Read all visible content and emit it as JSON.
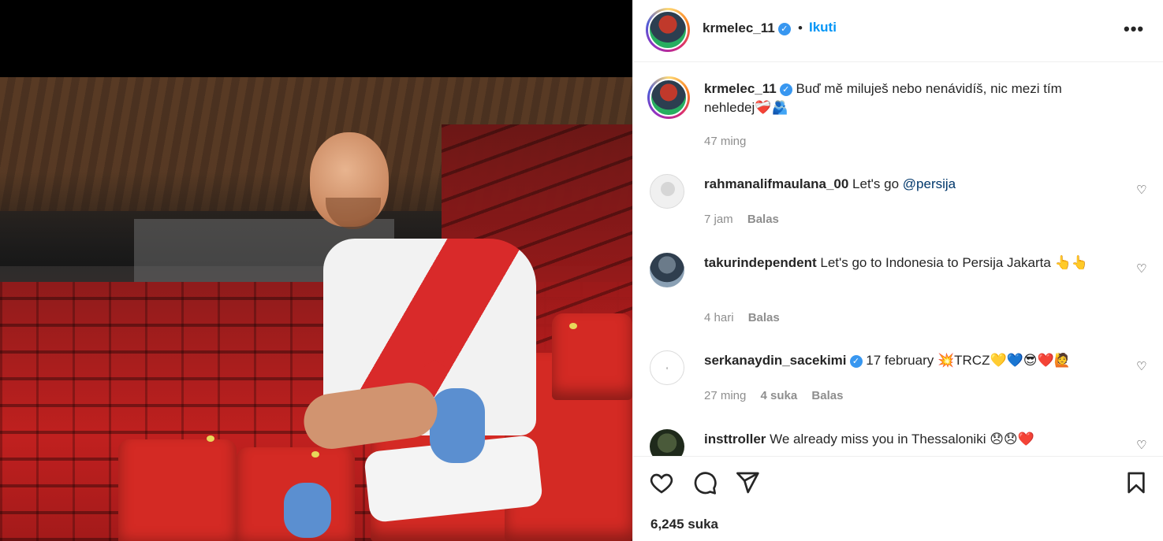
{
  "post": {
    "username": "krmelec_11",
    "verified_mark": "✓",
    "separator": "•",
    "follow_label": "Ikuti",
    "more_label": "•••"
  },
  "caption": {
    "username": "krmelec_11",
    "text": "Buď mě miluješ nebo nenávidíš, nic mezi tím nehledej❤️‍🩹🫂",
    "time": "47 ming"
  },
  "comments": [
    {
      "username": "rahmanalifmaulana_00",
      "text": "Let's go ",
      "mention": "@persija",
      "time": "7 jam",
      "likes": "",
      "reply_label": "Balas",
      "avatar": "default-avatar-icon"
    },
    {
      "username": "takurindependent",
      "text": "Let's go to Indonesia to Persija Jakarta 👆👆",
      "time": "4 hari",
      "likes": "",
      "reply_label": "Balas",
      "avatar": "user-photo"
    },
    {
      "username": "serkanaydin_sacekimi",
      "text": "17 february 💥TRCZ💛💙😎❤️🙋",
      "time": "27 ming",
      "likes": "4 suka",
      "reply_label": "Balas",
      "avatar": "logo"
    },
    {
      "username": "insttroller",
      "text": "We already miss you in Thessaloniki 😞😞❤️",
      "time": "",
      "likes": "",
      "reply_label": "",
      "avatar": "user-photo"
    }
  ],
  "actions": {
    "like": "heart-icon",
    "comment": "comment-icon",
    "share": "share-icon",
    "save": "bookmark-icon"
  },
  "likes_count": "6,245 suka",
  "colors": {
    "accent": "#0095f6",
    "text": "#262626",
    "muted": "#8e8e8e",
    "border": "#efefef"
  }
}
